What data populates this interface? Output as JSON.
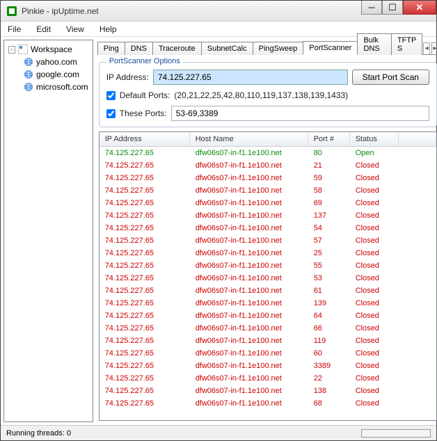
{
  "window_title": "Pinkie - ipUptime.net",
  "menu": [
    "File",
    "Edit",
    "View",
    "Help"
  ],
  "workspace": {
    "root": "Workspace",
    "items": [
      "yahoo.com",
      "google.com",
      "microsoft.com"
    ]
  },
  "tabs": {
    "items": [
      "Ping",
      "DNS",
      "Traceroute",
      "SubnetCalc",
      "PingSweep",
      "PortScanner",
      "Bulk DNS",
      "TFTP S"
    ],
    "active_index": 5
  },
  "options": {
    "group_title": "PortScanner Options",
    "ip_label": "IP Address:",
    "ip_value": "74.125.227.65",
    "scan_button": "Start Port Scan",
    "default_label": "Default Ports:",
    "default_checked": true,
    "default_value": "(20,21,22,25,42,80,110,119,137,138,139,1433)",
    "these_label": "These Ports:",
    "these_checked": true,
    "these_value": "53-69,3389"
  },
  "columns": [
    "IP Address",
    "Host Name",
    "Port #",
    "Status"
  ],
  "rows": [
    {
      "ip": "74.125.227.65",
      "host": "dfw06s07-in-f1.1e100.net",
      "port": "80",
      "status": "Open"
    },
    {
      "ip": "74.125.227.65",
      "host": "dfw06s07-in-f1.1e100.net",
      "port": "21",
      "status": "Closed"
    },
    {
      "ip": "74.125.227.65",
      "host": "dfw06s07-in-f1.1e100.net",
      "port": "59",
      "status": "Closed"
    },
    {
      "ip": "74.125.227.65",
      "host": "dfw06s07-in-f1.1e100.net",
      "port": "58",
      "status": "Closed"
    },
    {
      "ip": "74.125.227.65",
      "host": "dfw06s07-in-f1.1e100.net",
      "port": "69",
      "status": "Closed"
    },
    {
      "ip": "74.125.227.65",
      "host": "dfw06s07-in-f1.1e100.net",
      "port": "137",
      "status": "Closed"
    },
    {
      "ip": "74.125.227.65",
      "host": "dfw06s07-in-f1.1e100.net",
      "port": "54",
      "status": "Closed"
    },
    {
      "ip": "74.125.227.65",
      "host": "dfw06s07-in-f1.1e100.net",
      "port": "57",
      "status": "Closed"
    },
    {
      "ip": "74.125.227.65",
      "host": "dfw06s07-in-f1.1e100.net",
      "port": "25",
      "status": "Closed"
    },
    {
      "ip": "74.125.227.65",
      "host": "dfw06s07-in-f1.1e100.net",
      "port": "55",
      "status": "Closed"
    },
    {
      "ip": "74.125.227.65",
      "host": "dfw06s07-in-f1.1e100.net",
      "port": "53",
      "status": "Closed"
    },
    {
      "ip": "74.125.227.65",
      "host": "dfw06s07-in-f1.1e100.net",
      "port": "61",
      "status": "Closed"
    },
    {
      "ip": "74.125.227.65",
      "host": "dfw06s07-in-f1.1e100.net",
      "port": "139",
      "status": "Closed"
    },
    {
      "ip": "74.125.227.65",
      "host": "dfw06s07-in-f1.1e100.net",
      "port": "64",
      "status": "Closed"
    },
    {
      "ip": "74.125.227.65",
      "host": "dfw06s07-in-f1.1e100.net",
      "port": "66",
      "status": "Closed"
    },
    {
      "ip": "74.125.227.65",
      "host": "dfw06s07-in-f1.1e100.net",
      "port": "119",
      "status": "Closed"
    },
    {
      "ip": "74.125.227.65",
      "host": "dfw06s07-in-f1.1e100.net",
      "port": "60",
      "status": "Closed"
    },
    {
      "ip": "74.125.227.65",
      "host": "dfw06s07-in-f1.1e100.net",
      "port": "3389",
      "status": "Closed"
    },
    {
      "ip": "74.125.227.65",
      "host": "dfw06s07-in-f1.1e100.net",
      "port": "22",
      "status": "Closed"
    },
    {
      "ip": "74.125.227.65",
      "host": "dfw06s07-in-f1.1e100.net",
      "port": "138",
      "status": "Closed"
    },
    {
      "ip": "74.125.227.65",
      "host": "dfw06s07-in-f1.1e100.net",
      "port": "68",
      "status": "Closed"
    }
  ],
  "status_bar": "Running threads: 0"
}
